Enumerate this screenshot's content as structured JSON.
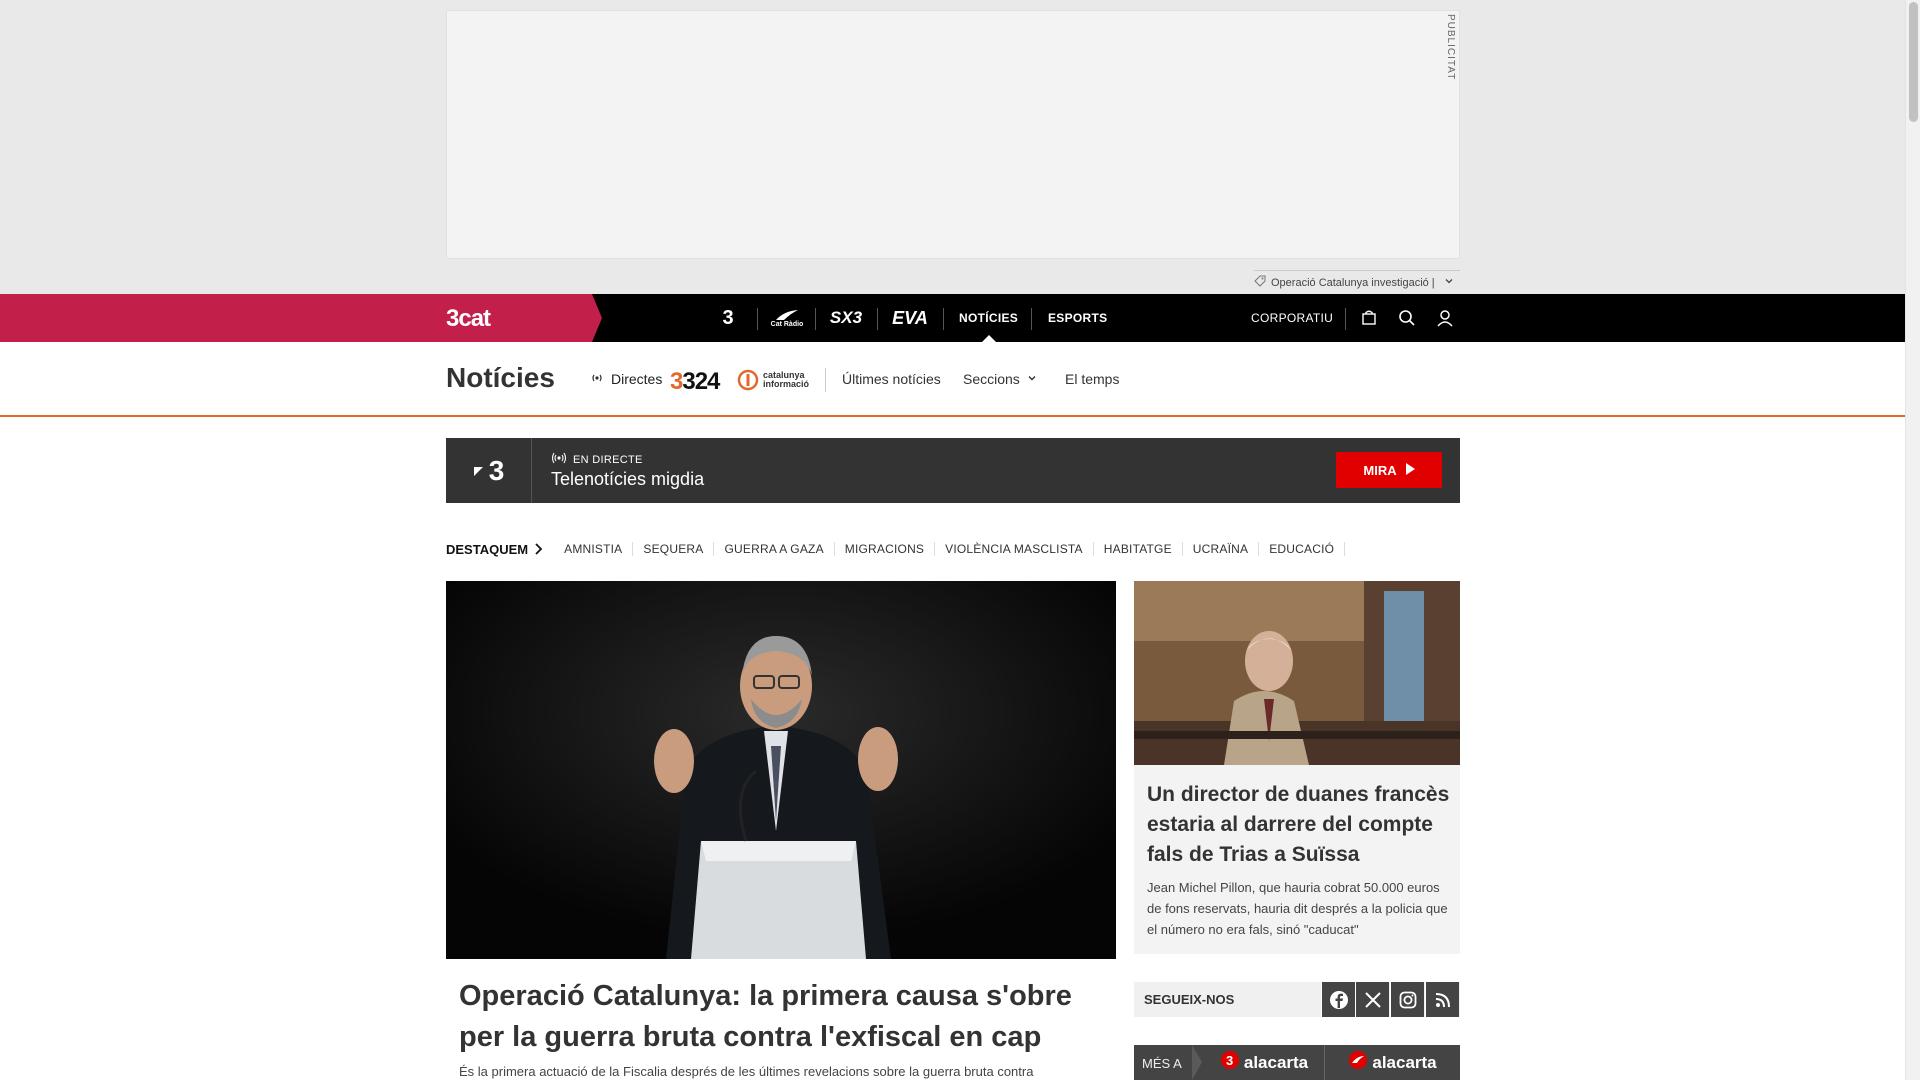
{
  "ad": {
    "label": "PUBLICITAT",
    "tag": "Operació Catalunya investigació |"
  },
  "topnav": {
    "brand": "3cat",
    "channels": [
      "3",
      "Cat Ràdio",
      "SX3",
      "EVA"
    ],
    "items": [
      {
        "label": "NOTÍCIES",
        "active": true
      },
      {
        "label": "ESPORTS",
        "active": false
      }
    ],
    "corporatiu": "CORPORATIU"
  },
  "section": {
    "title": "Notícies",
    "directes": "Directes",
    "logo_324": "324",
    "logo_ci_line1": "catalunya",
    "logo_ci_line2": "informació",
    "links": [
      "Últimes notícies",
      "Seccions",
      "El temps"
    ]
  },
  "live": {
    "channel": "3",
    "tag": "EN DIRECTE",
    "program": "Telenotícies migdia",
    "button": "MIRA"
  },
  "destaquem": {
    "label": "DESTAQUEM",
    "items": [
      "AMNISTIA",
      "SEQUERA",
      "GUERRA A GAZA",
      "MIGRACIONS",
      "VIOLÈNCIA MASCLISTA",
      "HABITATGE",
      "UCRAÏNA",
      "EDUCACIÓ"
    ]
  },
  "main_article": {
    "title": "Operació Catalunya: la primera causa s'obre per la guerra bruta contra l'exfiscal en cap",
    "summary": "És la primera actuació de la Fiscalia després de les últimes revelacions sobre la guerra bruta contra"
  },
  "side_article": {
    "title": "Un director de duanes francès estaria al darrere del compte fals de Trias a Suïssa",
    "summary": "Jean Michel Pillon, que hauria cobrat 50.000 euros de fons reservats, hauria dit després a la policia que el número no era fals, sinó \"caducat\""
  },
  "follow": {
    "label": "SEGUEIX-NOS",
    "networks": [
      "facebook-icon",
      "x-icon",
      "instagram-icon",
      "rss-icon"
    ]
  },
  "mes": {
    "label": "MÉS A",
    "item1": "alacarta",
    "item2": "alacarta"
  },
  "colors": {
    "brand": "#c21f4a",
    "accent": "#e06a2a",
    "live_button": "#e00000"
  }
}
